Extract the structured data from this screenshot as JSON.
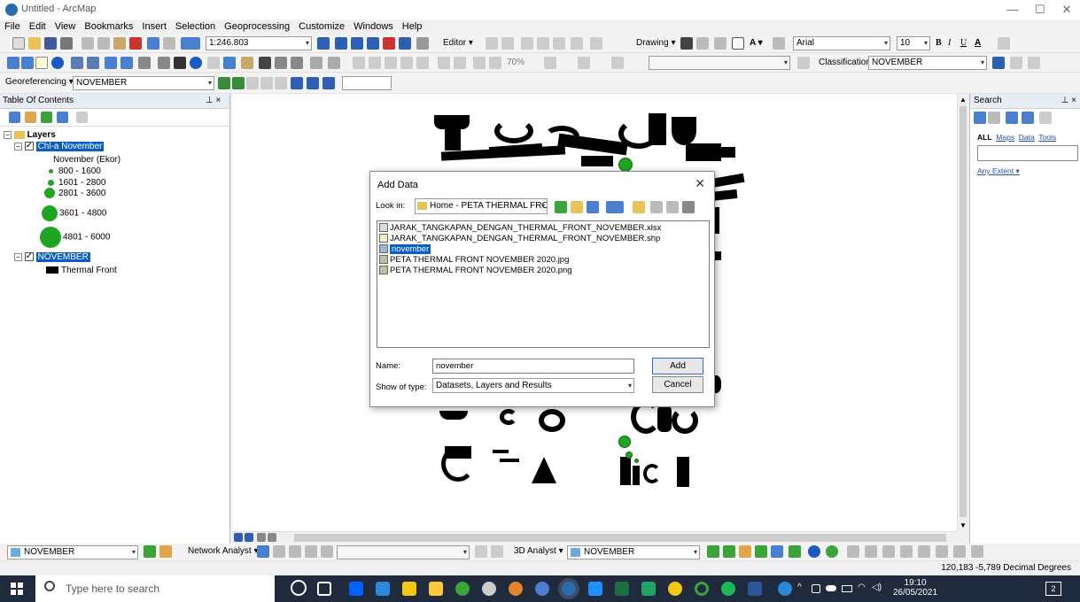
{
  "window": {
    "title": "Untitled - ArcMap",
    "minimize": "—",
    "maximize": "☐",
    "close": "✕"
  },
  "menu": [
    "File",
    "Edit",
    "View",
    "Bookmarks",
    "Insert",
    "Selection",
    "Geoprocessing",
    "Customize",
    "Windows",
    "Help"
  ],
  "toolbar": {
    "scale": "1:246.803",
    "editor": "Editor ▾",
    "drawing": "Drawing ▾",
    "font": "Arial",
    "font_size": "10",
    "bold": "B",
    "italic": "I",
    "underline": "U",
    "font_color": "A",
    "zoom_pct": "70%",
    "classification": "Classification ▾",
    "class_layer": "NOVEMBER"
  },
  "georef": {
    "label": "Georeferencing ▾",
    "layer": "NOVEMBER"
  },
  "toc": {
    "title": "Table Of Contents",
    "pin": "⊥ ×",
    "root": "Layers",
    "layer1": "Chl-a November",
    "layer1_field": "November (Ekor)",
    "classes": [
      {
        "label": "800 - 1600"
      },
      {
        "label": "1601 - 2800"
      },
      {
        "label": "2801 - 3600"
      },
      {
        "label": "3601 - 4800"
      },
      {
        "label": "4801 - 6000"
      }
    ],
    "layer2": "NOVEMBER",
    "layer2_item": "Thermal Front"
  },
  "search": {
    "title": "Search",
    "pin": "⊥ ×",
    "tabs": [
      "ALL",
      "Maps",
      "Data",
      "Tools"
    ],
    "extent": "Any Extent ▾"
  },
  "dialog": {
    "title": "Add Data",
    "close": "✕",
    "look_in_label": "Look in:",
    "look_in_value": "Home - PETA THERMAL FRONT",
    "files": [
      "JARAK_TANGKAPAN_DENGAN_THERMAL_FRONT_NOVEMBER.xlsx",
      "JARAK_TANGKAPAN_DENGAN_THERMAL_FRONT_NOVEMBER.shp",
      "november",
      "PETA THERMAL FRONT NOVEMBER 2020.jpg",
      "PETA THERMAL FRONT NOVEMBER 2020.png"
    ],
    "name_label": "Name:",
    "name_value": "november",
    "type_label": "Show of type:",
    "type_value": "Datasets, Layers and Results",
    "add": "Add",
    "cancel": "Cancel"
  },
  "bottom_toolbar": {
    "layer": "NOVEMBER",
    "network": "Network Analyst ▾",
    "analyst3d": "3D Analyst ▾",
    "layer2": "NOVEMBER"
  },
  "status": {
    "coords": "120,183  -5,789 Decimal Degrees"
  },
  "taskbar": {
    "search": "Type here to search",
    "time": "19:10",
    "date": "26/05/2021",
    "notif": "2"
  },
  "colors": {
    "selection": "#0a5ec2",
    "green_symbol": "#1fa521",
    "taskbar": "#1f2a3c"
  }
}
